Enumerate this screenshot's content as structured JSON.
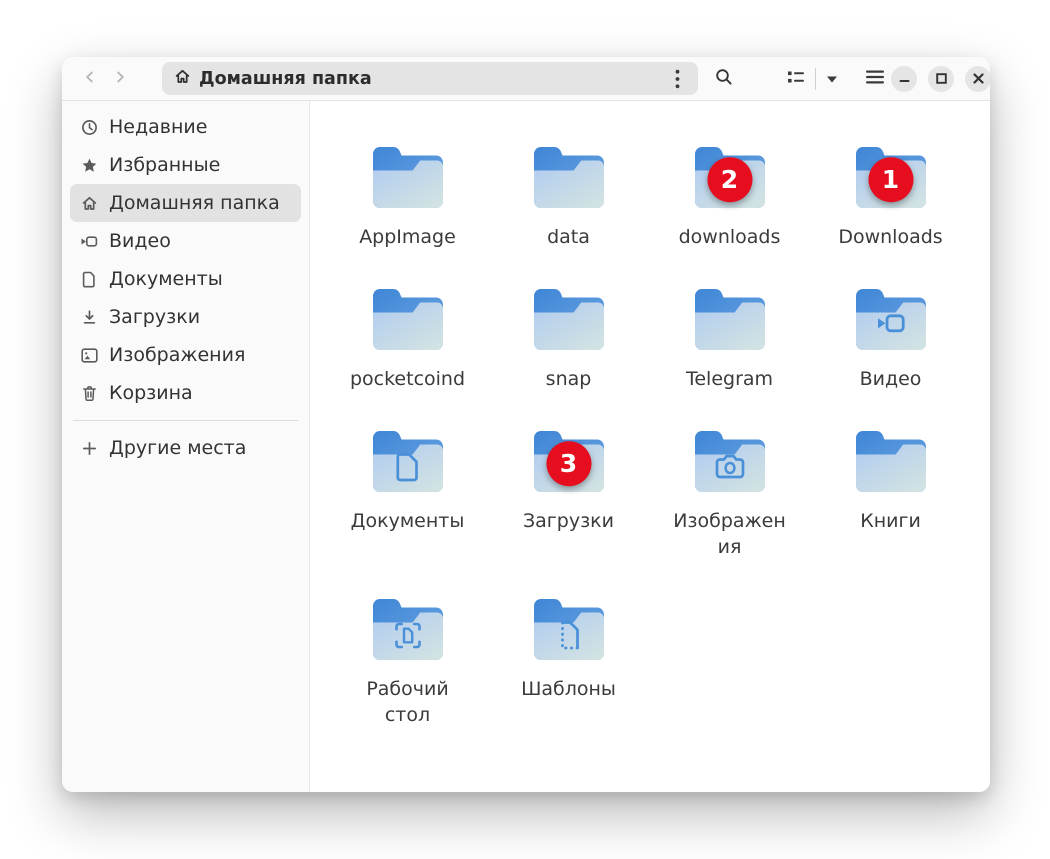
{
  "header": {
    "path_label": "Домашняя папка",
    "icons": [
      "back-icon",
      "forward-icon",
      "home-icon",
      "kebab-menu-icon",
      "search-icon",
      "list-view-icon",
      "dropdown-arrow-icon",
      "hamburger-menu-icon",
      "minimize-icon",
      "maximize-icon",
      "close-icon"
    ]
  },
  "sidebar": {
    "items": [
      {
        "icon": "recent-icon",
        "label": "Недавние",
        "selected": false
      },
      {
        "icon": "star-icon",
        "label": "Избранные",
        "selected": false
      },
      {
        "icon": "home-icon",
        "label": "Домашняя папка",
        "selected": true
      },
      {
        "icon": "video-icon",
        "label": "Видео",
        "selected": false
      },
      {
        "icon": "documents-icon",
        "label": "Документы",
        "selected": false
      },
      {
        "icon": "downloads-icon",
        "label": "Загрузки",
        "selected": false
      },
      {
        "icon": "images-icon",
        "label": "Изображения",
        "selected": false
      },
      {
        "icon": "trash-icon",
        "label": "Корзина",
        "selected": false
      }
    ],
    "other_places": {
      "icon": "plus-icon",
      "label": "Другие места"
    }
  },
  "files": {
    "items": [
      {
        "label": "AppImage",
        "emblem": null,
        "badge": null
      },
      {
        "label": "data",
        "emblem": null,
        "badge": null
      },
      {
        "label": "downloads",
        "emblem": null,
        "badge": "2"
      },
      {
        "label": "Downloads",
        "emblem": null,
        "badge": "1"
      },
      {
        "label": "pocketcoind",
        "emblem": null,
        "badge": null
      },
      {
        "label": "snap",
        "emblem": null,
        "badge": null
      },
      {
        "label": "Telegram",
        "emblem": null,
        "badge": null
      },
      {
        "label": "Видео",
        "emblem": "video-emblem-icon",
        "badge": null
      },
      {
        "label": "Документы",
        "emblem": "document-emblem-icon",
        "badge": null
      },
      {
        "label": "Загрузки",
        "emblem": null,
        "badge": "3"
      },
      {
        "label": "Изображения",
        "emblem": "camera-emblem-icon",
        "badge": null
      },
      {
        "label": "Книги",
        "emblem": null,
        "badge": null
      },
      {
        "label": "Рабочий стол",
        "emblem": "desktop-emblem-icon",
        "badge": null
      },
      {
        "label": "Шаблоны",
        "emblem": "template-emblem-icon",
        "badge": null
      }
    ]
  },
  "colors": {
    "badge_red": "#e60d1e",
    "folder_tab_blue": "#4289d8",
    "folder_body_blue": "#b3cdf1",
    "emblem_blue": "#4a90d9",
    "selection_gray": "#e2e2e2",
    "header_bg": "#fafafa"
  }
}
